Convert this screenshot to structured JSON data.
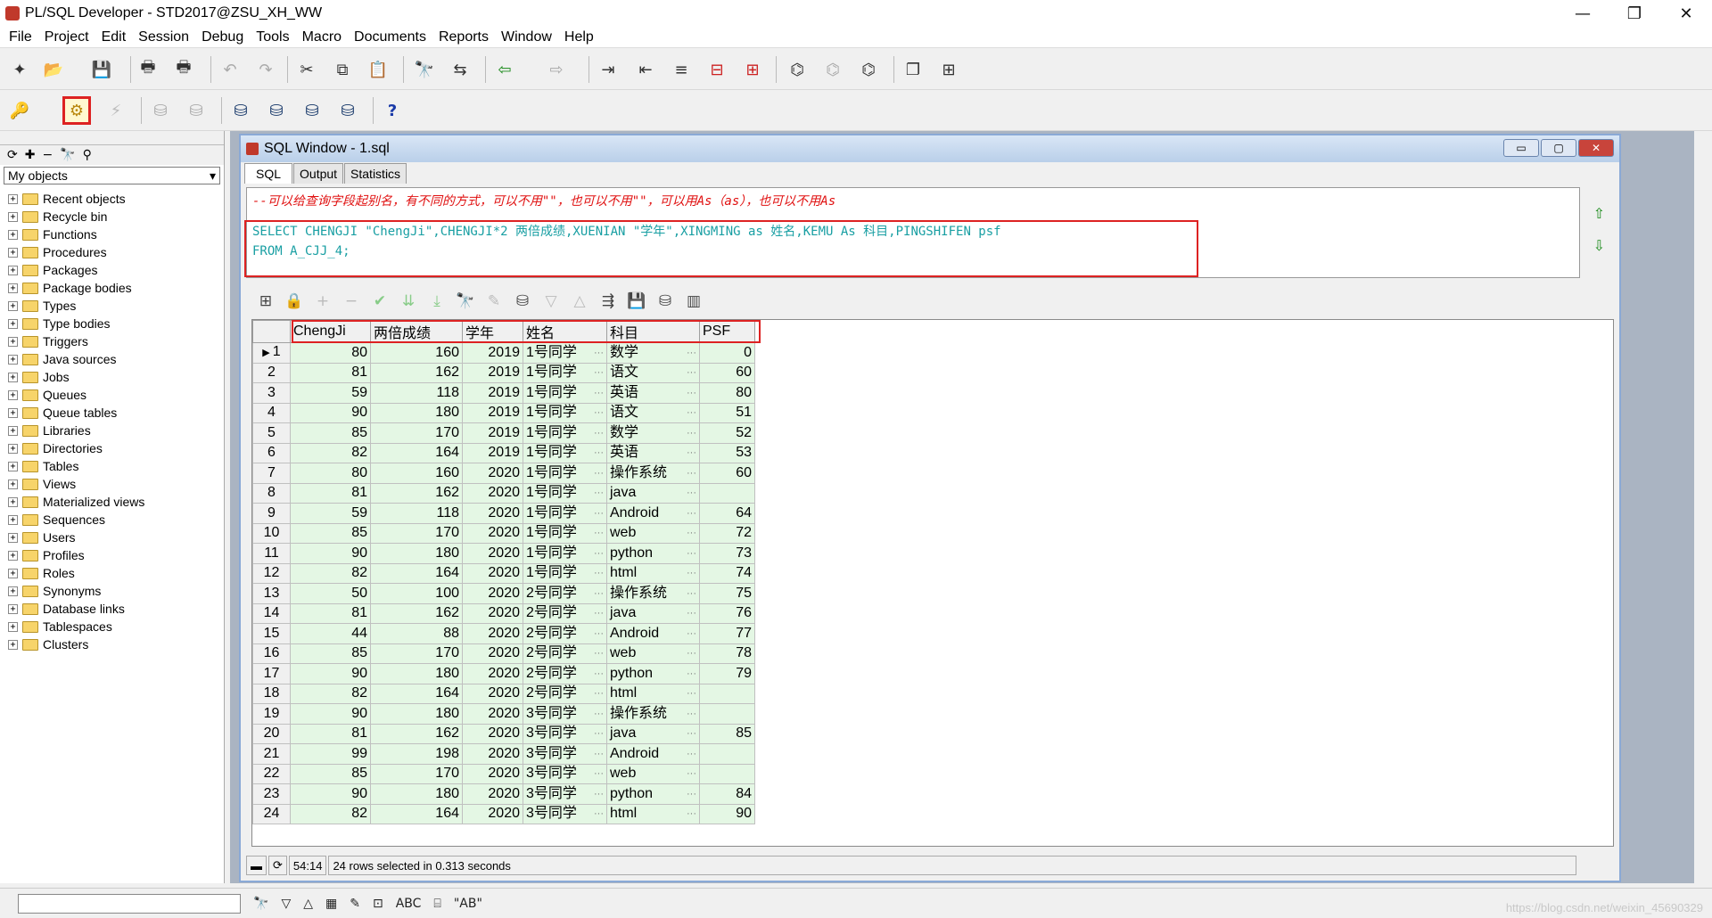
{
  "window": {
    "title": "PL/SQL Developer - STD2017@ZSU_XH_WW",
    "minimize": "—",
    "maximize": "❐",
    "close": "✕"
  },
  "menu": [
    "File",
    "Project",
    "Edit",
    "Session",
    "Debug",
    "Tools",
    "Macro",
    "Documents",
    "Reports",
    "Window",
    "Help"
  ],
  "left_panel": {
    "select": "My objects",
    "items": [
      "Recent objects",
      "Recycle bin",
      "Functions",
      "Procedures",
      "Packages",
      "Package bodies",
      "Types",
      "Type bodies",
      "Triggers",
      "Java sources",
      "Jobs",
      "Queues",
      "Queue tables",
      "Libraries",
      "Directories",
      "Tables",
      "Views",
      "Materialized views",
      "Sequences",
      "Users",
      "Profiles",
      "Roles",
      "Synonyms",
      "Database links",
      "Tablespaces",
      "Clusters"
    ]
  },
  "sql_window": {
    "title": "SQL Window - 1.sql",
    "tabs": [
      "SQL",
      "Output",
      "Statistics"
    ],
    "comment": "--可以给查询字段起别名，有不同的方式，可以不用\"\"，也可以不用\"\"，可以用As（as），也可以不用As",
    "line1": "SELECT CHENGJI \"ChengJi\",CHENGJI*2 两倍成绩,XUENIAN \"学年\",XINGMING as 姓名,KEMU As 科目,PINGSHIFEN psf",
    "line2": "FROM A_CJJ_4;"
  },
  "results": {
    "columns": [
      "ChengJi",
      "两倍成绩",
      "学年",
      "姓名",
      "科目",
      "PSF"
    ],
    "rows": [
      [
        "1",
        "80",
        "160",
        "2019",
        "1号同学",
        "数学",
        "0"
      ],
      [
        "2",
        "81",
        "162",
        "2019",
        "1号同学",
        "语文",
        "60"
      ],
      [
        "3",
        "59",
        "118",
        "2019",
        "1号同学",
        "英语",
        "80"
      ],
      [
        "4",
        "90",
        "180",
        "2019",
        "1号同学",
        "语文",
        "51"
      ],
      [
        "5",
        "85",
        "170",
        "2019",
        "1号同学",
        "数学",
        "52"
      ],
      [
        "6",
        "82",
        "164",
        "2019",
        "1号同学",
        "英语",
        "53"
      ],
      [
        "7",
        "80",
        "160",
        "2020",
        "1号同学",
        "操作系统",
        "60"
      ],
      [
        "8",
        "81",
        "162",
        "2020",
        "1号同学",
        "java",
        ""
      ],
      [
        "9",
        "59",
        "118",
        "2020",
        "1号同学",
        "Android",
        "64"
      ],
      [
        "10",
        "85",
        "170",
        "2020",
        "1号同学",
        "web",
        "72"
      ],
      [
        "11",
        "90",
        "180",
        "2020",
        "1号同学",
        "python",
        "73"
      ],
      [
        "12",
        "82",
        "164",
        "2020",
        "1号同学",
        "html",
        "74"
      ],
      [
        "13",
        "50",
        "100",
        "2020",
        "2号同学",
        "操作系统",
        "75"
      ],
      [
        "14",
        "81",
        "162",
        "2020",
        "2号同学",
        "java",
        "76"
      ],
      [
        "15",
        "44",
        "88",
        "2020",
        "2号同学",
        "Android",
        "77"
      ],
      [
        "16",
        "85",
        "170",
        "2020",
        "2号同学",
        "web",
        "78"
      ],
      [
        "17",
        "90",
        "180",
        "2020",
        "2号同学",
        "python",
        "79"
      ],
      [
        "18",
        "82",
        "164",
        "2020",
        "2号同学",
        "html",
        ""
      ],
      [
        "19",
        "90",
        "180",
        "2020",
        "3号同学",
        "操作系统",
        ""
      ],
      [
        "20",
        "81",
        "162",
        "2020",
        "3号同学",
        "java",
        "85"
      ],
      [
        "21",
        "99",
        "198",
        "2020",
        "3号同学",
        "Android",
        ""
      ],
      [
        "22",
        "85",
        "170",
        "2020",
        "3号同学",
        "web",
        ""
      ],
      [
        "23",
        "90",
        "180",
        "2020",
        "3号同学",
        "python",
        "84"
      ],
      [
        "24",
        "82",
        "164",
        "2020",
        "3号同学",
        "html",
        "90"
      ]
    ]
  },
  "status": {
    "position": "54:14",
    "message": "24 rows selected in 0.313 seconds"
  },
  "bottom": {
    "abc": "ABC",
    "ab": "\"AB\""
  },
  "watermark": "https://blog.csdn.net/weixin_45690329"
}
